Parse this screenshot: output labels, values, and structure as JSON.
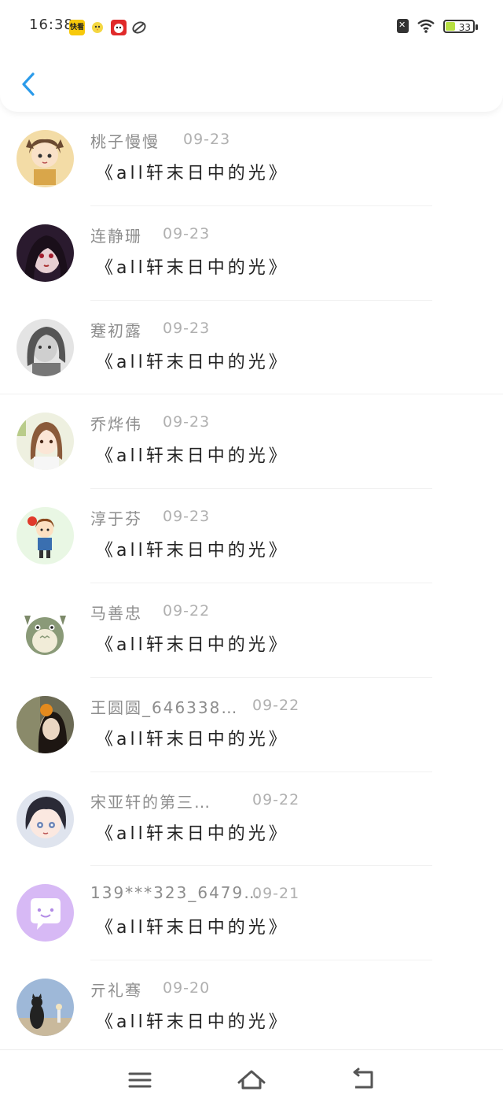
{
  "status_bar": {
    "time": "16:38",
    "notification_icons": [
      "kuaikan-app-icon",
      "chick-app-icon",
      "red-app-icon",
      "leaf-app-icon"
    ],
    "battery_level": "33"
  },
  "header": {
    "back_icon": "chevron-left-icon",
    "accent_color": "#2b9bea"
  },
  "messages": [
    {
      "name": "桃子慢慢",
      "date": "09-23",
      "text": "《all轩末日中的光》",
      "avatar": "cartoon-boy-avatar"
    },
    {
      "name": "连静珊",
      "date": "09-23",
      "text": "《all轩末日中的光》",
      "avatar": "dark-anime-girl-avatar"
    },
    {
      "name": "蹇初露",
      "date": "09-23",
      "text": "《all轩末日中的光》",
      "avatar": "grey-anime-avatar"
    },
    {
      "name": "乔烨伟",
      "date": "09-23",
      "text": "《all轩末日中的光》",
      "avatar": "anime-girl-avatar"
    },
    {
      "name": "淳于芬",
      "date": "09-23",
      "text": "《all轩末日中的光》",
      "avatar": "cartoon-kid-avatar"
    },
    {
      "name": "马善忠",
      "date": "09-22",
      "text": "《all轩末日中的光》",
      "avatar": "totoro-avatar"
    },
    {
      "name": "王圆圆_646338…",
      "date": "09-22",
      "text": "《all轩末日中的光》",
      "avatar": "photo-girl-avatar"
    },
    {
      "name": "宋亚轩的第三…",
      "date": "09-22",
      "text": "《all轩末日中的光》",
      "avatar": "chibi-boy-avatar"
    },
    {
      "name": "139***323_6479…",
      "date": "09-21",
      "text": "《all轩末日中的光》",
      "avatar": "chat-bubble-avatar"
    },
    {
      "name": "亓礼骞",
      "date": "09-20",
      "text": "《all轩末日中的光》",
      "avatar": "black-cat-avatar"
    }
  ],
  "nav_bar": {
    "buttons": [
      "menu-icon",
      "home-icon",
      "back-icon"
    ]
  }
}
